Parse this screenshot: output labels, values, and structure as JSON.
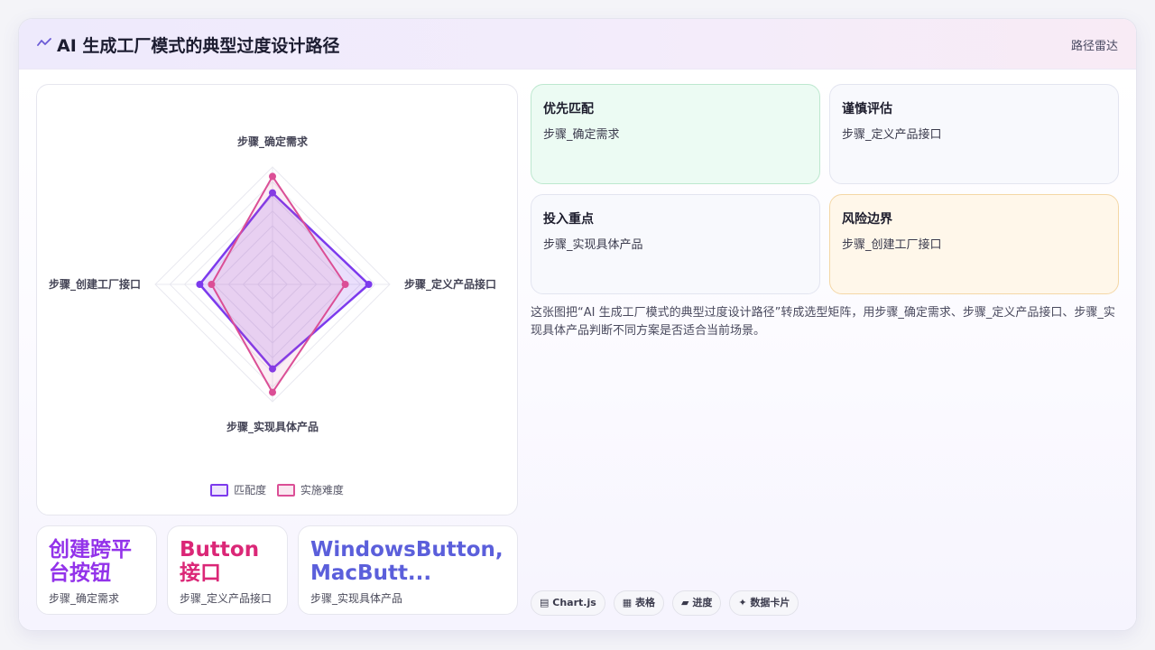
{
  "header": {
    "icon": "sparkline-icon",
    "title": "AI 生成工厂模式的典型过度设计路径",
    "link": "路径雷达"
  },
  "chart_data": {
    "type": "radar",
    "axes": [
      "步骤_确定需求",
      "步骤_定义产品接口",
      "步骤_实现具体产品",
      "步骤_创建工厂接口"
    ],
    "series": [
      {
        "name": "匹配度",
        "color": "#7c3aed",
        "values": [
          78,
          82,
          72,
          62
        ]
      },
      {
        "name": "实施难度",
        "color": "#db4f96",
        "values": [
          92,
          62,
          92,
          52
        ]
      }
    ],
    "rlim": [
      0,
      100
    ],
    "grid": true,
    "legend": "bottom"
  },
  "metrics": [
    {
      "value": "创建跨平台按钮",
      "label": "步骤_确定需求",
      "color": "#9333ea"
    },
    {
      "value": "Button 接口",
      "label": "步骤_定义产品接口",
      "color": "#db2777"
    },
    {
      "value": "WindowsButton, MacButt...",
      "label": "步骤_实现具体产品",
      "color": "#5b5fdb"
    }
  ],
  "quadrants": [
    {
      "title": "优先匹配",
      "value": "步骤_确定需求",
      "bg": "#ecfbf3",
      "border": "#bde8cf"
    },
    {
      "title": "谨慎评估",
      "value": "步骤_定义产品接口",
      "bg": "#f8f9fd",
      "border": "#e3e5f0"
    },
    {
      "title": "投入重点",
      "value": "步骤_实现具体产品",
      "bg": "#f8f9fd",
      "border": "#e3e5f0"
    },
    {
      "title": "风险边界",
      "value": "步骤_创建工厂接口",
      "bg": "#fff7ea",
      "border": "#f4d7a6"
    }
  ],
  "description": "这张图把“AI 生成工厂模式的典型过度设计路径”转成选型矩阵，用步骤_确定需求、步骤_定义产品接口、步骤_实现具体产品判断不同方案是否适合当前场景。",
  "tags": [
    {
      "icon": "chart-icon",
      "glyph": "▤",
      "label": "Chart.js"
    },
    {
      "icon": "table-icon",
      "glyph": "▦",
      "label": "表格"
    },
    {
      "icon": "progress-icon",
      "glyph": "▰",
      "label": "进度"
    },
    {
      "icon": "data-card-icon",
      "glyph": "✦",
      "label": "数据卡片"
    }
  ]
}
